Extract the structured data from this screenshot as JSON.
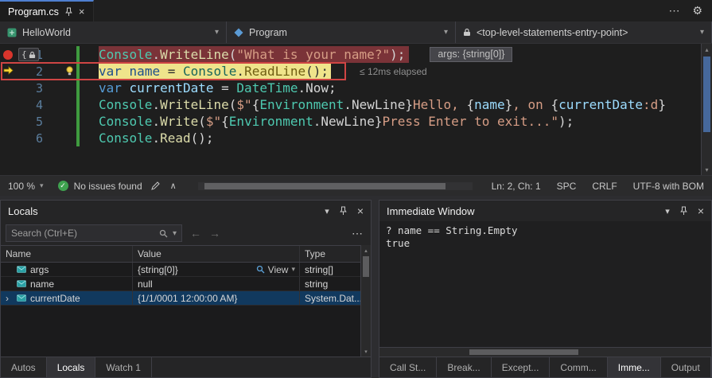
{
  "icons": {
    "gear": "⚙",
    "more": "⋯",
    "caret_down": "▾",
    "close": "×",
    "back": "←",
    "forward": "→",
    "chevron_right": "›",
    "collapse": "∧",
    "scroll_up": "▴",
    "scroll_down": "▾",
    "check": "✓"
  },
  "tabbar": {
    "active_tab": "Program.cs"
  },
  "navbar": {
    "project": "HelloWorld",
    "type": "Program",
    "member": "<top-level-statements-entry-point>"
  },
  "editor": {
    "datatip": "args: {string[0]}",
    "perftip": "≤ 12ms elapsed",
    "lines": [
      {
        "num": "1",
        "highlight": "breakpoint",
        "glyph": "breakpoint-lock",
        "has_datatip": true,
        "tokens": [
          {
            "t": "Console",
            "c": "type"
          },
          {
            "t": ".",
            "c": "plain"
          },
          {
            "t": "WriteLine",
            "c": "method"
          },
          {
            "t": "(",
            "c": "plain"
          },
          {
            "t": "\"What is your name?\"",
            "c": "string"
          },
          {
            "t": ");",
            "c": "plain"
          }
        ]
      },
      {
        "num": "2",
        "highlight": "current",
        "glyph": "current-arrow",
        "boxed": true,
        "bulb": true,
        "has_perftip": true,
        "tokens": [
          {
            "t": "var",
            "c": "kw2"
          },
          {
            "t": " ",
            "c": "plain2"
          },
          {
            "t": "name",
            "c": "local2"
          },
          {
            "t": " = ",
            "c": "plain2"
          },
          {
            "t": "Console",
            "c": "type2"
          },
          {
            "t": ".",
            "c": "plain2"
          },
          {
            "t": "ReadLine",
            "c": "method2"
          },
          {
            "t": "();",
            "c": "plain2"
          }
        ]
      },
      {
        "num": "3",
        "tokens": [
          {
            "t": "var",
            "c": "kw"
          },
          {
            "t": " ",
            "c": "plain"
          },
          {
            "t": "currentDate",
            "c": "local"
          },
          {
            "t": " = ",
            "c": "plain"
          },
          {
            "t": "DateTime",
            "c": "type"
          },
          {
            "t": ".",
            "c": "plain"
          },
          {
            "t": "Now",
            "c": "plain"
          },
          {
            "t": ";",
            "c": "plain"
          }
        ]
      },
      {
        "num": "4",
        "tokens": [
          {
            "t": "Console",
            "c": "type"
          },
          {
            "t": ".",
            "c": "plain"
          },
          {
            "t": "WriteLine",
            "c": "method"
          },
          {
            "t": "(",
            "c": "plain"
          },
          {
            "t": "$\"",
            "c": "string"
          },
          {
            "t": "{",
            "c": "plain"
          },
          {
            "t": "Environment",
            "c": "type"
          },
          {
            "t": ".",
            "c": "plain"
          },
          {
            "t": "NewLine",
            "c": "plain"
          },
          {
            "t": "}",
            "c": "plain"
          },
          {
            "t": "Hello, ",
            "c": "string"
          },
          {
            "t": "{",
            "c": "plain"
          },
          {
            "t": "name",
            "c": "local"
          },
          {
            "t": "}",
            "c": "plain"
          },
          {
            "t": ", on ",
            "c": "string"
          },
          {
            "t": "{",
            "c": "plain"
          },
          {
            "t": "currentDate",
            "c": "local"
          },
          {
            "t": ":d",
            "c": "string"
          },
          {
            "t": "}",
            "c": "plain"
          }
        ]
      },
      {
        "num": "5",
        "tokens": [
          {
            "t": "Console",
            "c": "type"
          },
          {
            "t": ".",
            "c": "plain"
          },
          {
            "t": "Write",
            "c": "method"
          },
          {
            "t": "(",
            "c": "plain"
          },
          {
            "t": "$\"",
            "c": "string"
          },
          {
            "t": "{",
            "c": "plain"
          },
          {
            "t": "Environment",
            "c": "type"
          },
          {
            "t": ".",
            "c": "plain"
          },
          {
            "t": "NewLine",
            "c": "plain"
          },
          {
            "t": "}",
            "c": "plain"
          },
          {
            "t": "Press Enter to exit...\"",
            "c": "string"
          },
          {
            "t": ");",
            "c": "plain"
          }
        ]
      },
      {
        "num": "6",
        "tokens": [
          {
            "t": "Console",
            "c": "type"
          },
          {
            "t": ".",
            "c": "plain"
          },
          {
            "t": "Read",
            "c": "method"
          },
          {
            "t": "();",
            "c": "plain"
          }
        ]
      }
    ]
  },
  "statusbar": {
    "zoom": "100 %",
    "issues": "No issues found",
    "line_info": "Ln: 2, Ch: 1",
    "spaces": "SPC",
    "line_ending": "CRLF",
    "encoding": "UTF-8 with BOM"
  },
  "locals": {
    "title": "Locals",
    "search_placeholder": "Search (Ctrl+E)",
    "columns": [
      "Name",
      "Value",
      "Type"
    ],
    "view_label": "View",
    "rows": [
      {
        "name": "args",
        "value": "{string[0]}",
        "type": "string[]",
        "view": true
      },
      {
        "name": "name",
        "value": "null",
        "type": "string"
      },
      {
        "name": "currentDate",
        "value": "{1/1/0001 12:00:00 AM}",
        "type": "System.Dat...",
        "expandable": true,
        "selected": true
      }
    ],
    "tabs": [
      {
        "label": "Autos",
        "active": false
      },
      {
        "label": "Locals",
        "active": true
      },
      {
        "label": "Watch 1",
        "active": false
      }
    ]
  },
  "immediate": {
    "title": "Immediate Window",
    "lines": [
      "? name == String.Empty",
      "true"
    ],
    "tabs": [
      {
        "label": "Call St...",
        "active": false
      },
      {
        "label": "Break...",
        "active": false
      },
      {
        "label": "Except...",
        "active": false
      },
      {
        "label": "Comm...",
        "active": false
      },
      {
        "label": "Imme...",
        "active": true
      },
      {
        "label": "Output",
        "active": false
      }
    ]
  },
  "colors": {
    "accent_tab": "#4e7fd0",
    "breakpoint_line_bg": "#7a3338",
    "current_line_bg": "#efe48b",
    "annotation_red": "#cf4544",
    "change_bar": "#3f9b3f",
    "line_number": "#5b7e9e",
    "token_keyword": "#569cd6",
    "token_type": "#4ec9b0",
    "token_method": "#dcdcaa",
    "token_string": "#d69d85",
    "token_local": "#9cdcfe",
    "token_plain": "#d4d4d4",
    "token_keyword_y": "#1d4f8c",
    "token_type_y": "#18665a",
    "token_method_y": "#6f5e12",
    "token_plain_y": "#2f2f2f",
    "token_local_y": "#1d4f8c",
    "issues_green": "#3fa24f",
    "breakpoint_red": "#d8352c",
    "arrow_yellow": "#ffd83b",
    "scrollbar_thumb_blue": "#46689b",
    "selection_row_bg": "#11395e"
  }
}
